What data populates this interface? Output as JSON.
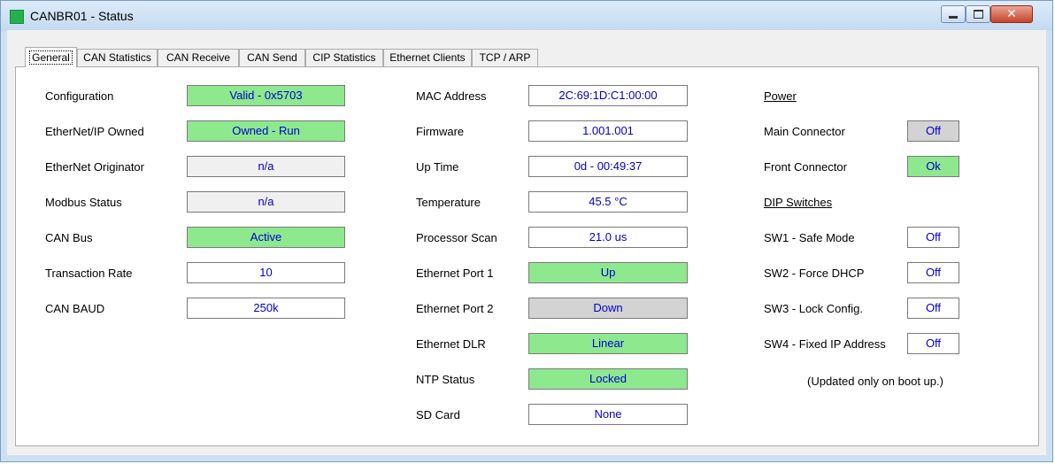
{
  "window": {
    "title": "CANBR01 - Status",
    "close_glyph": "✕"
  },
  "tabs": [
    "General",
    "CAN Statistics",
    "CAN Receive",
    "CAN Send",
    "CIP Statistics",
    "Ethernet Clients",
    "TCP / ARP"
  ],
  "left": [
    {
      "label": "Configuration",
      "value": "Valid - 0x5703"
    },
    {
      "label": "EtherNet/IP Owned",
      "value": "Owned - Run"
    },
    {
      "label": "EtherNet Originator",
      "value": "n/a"
    },
    {
      "label": "Modbus Status",
      "value": "n/a"
    },
    {
      "label": "CAN Bus",
      "value": "Active"
    },
    {
      "label": "Transaction Rate",
      "value": "10"
    },
    {
      "label": "CAN BAUD",
      "value": "250k"
    }
  ],
  "middle": [
    {
      "label": "MAC Address",
      "value": "2C:69:1D:C1:00:00"
    },
    {
      "label": "Firmware",
      "value": "1.001.001"
    },
    {
      "label": "Up Time",
      "value": "0d - 00:49:37"
    },
    {
      "label": "Temperature",
      "value": "45.5 °C"
    },
    {
      "label": "Processor Scan",
      "value": "21.0 us"
    },
    {
      "label": "Ethernet Port 1",
      "value": "Up"
    },
    {
      "label": "Ethernet Port 2",
      "value": "Down"
    },
    {
      "label": "Ethernet DLR",
      "value": "Linear"
    },
    {
      "label": "NTP Status",
      "value": "Locked"
    },
    {
      "label": "SD Card",
      "value": "None"
    }
  ],
  "right": {
    "power_heading": "Power",
    "power": [
      {
        "label": "Main Connector",
        "value": "Off"
      },
      {
        "label": "Front Connector",
        "value": "Ok"
      }
    ],
    "dip_heading": "DIP Switches",
    "dip": [
      {
        "label": "SW1 - Safe Mode",
        "value": "Off"
      },
      {
        "label": "SW2 - Force DHCP",
        "value": "Off"
      },
      {
        "label": "SW3 - Lock Config.",
        "value": "Off"
      },
      {
        "label": "SW4 - Fixed IP Address",
        "value": "Off"
      }
    ],
    "note": "(Updated only on boot up.)"
  },
  "colors": {
    "ok_green": "#8ee88e",
    "neutral_gray": "#f0f0f0",
    "down_gray": "#d3d3d3",
    "value_text": "#0000cc"
  }
}
